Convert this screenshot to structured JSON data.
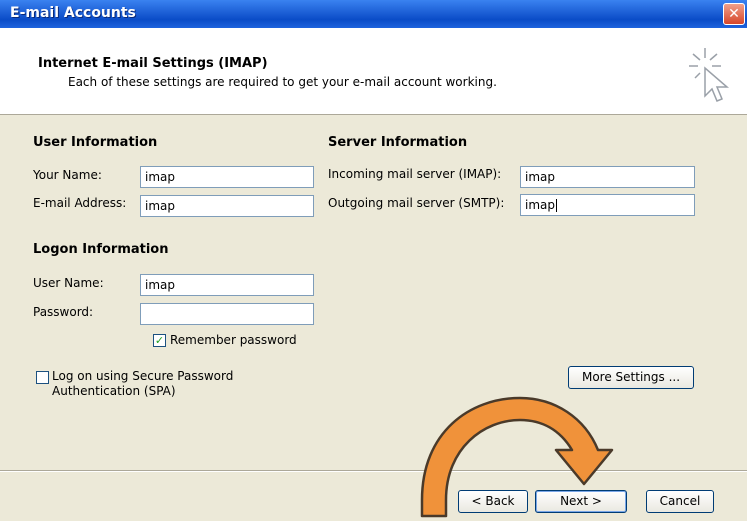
{
  "window": {
    "title": "E-mail Accounts",
    "close_glyph": "✕"
  },
  "header": {
    "title": "Internet E-mail Settings (IMAP)",
    "subtitle": "Each of these settings are required to get your e-mail account working.",
    "icon": "cursor-sparkle-icon"
  },
  "user_info": {
    "heading": "User Information",
    "name_label": "Your Name:",
    "name_value": "imap",
    "email_label": "E-mail Address:",
    "email_value": "imap"
  },
  "server_info": {
    "heading": "Server Information",
    "incoming_label": "Incoming mail server (IMAP):",
    "incoming_value": "imap",
    "outgoing_label": "Outgoing mail server (SMTP):",
    "outgoing_value": "imap"
  },
  "logon_info": {
    "heading": "Logon Information",
    "username_label": "User Name:",
    "username_value": "imap",
    "password_label": "Password:",
    "password_value": "",
    "remember_label": "Remember password",
    "remember_checked": true,
    "spa_label_line1": "Log on using Secure Password",
    "spa_label_line2": "Authentication (SPA)",
    "spa_checked": false
  },
  "buttons": {
    "more_settings": "More Settings ...",
    "back": "< Back",
    "next": "Next >",
    "cancel": "Cancel"
  },
  "annotation": {
    "color": "#F0923A",
    "outline": "#4a3a2a"
  }
}
